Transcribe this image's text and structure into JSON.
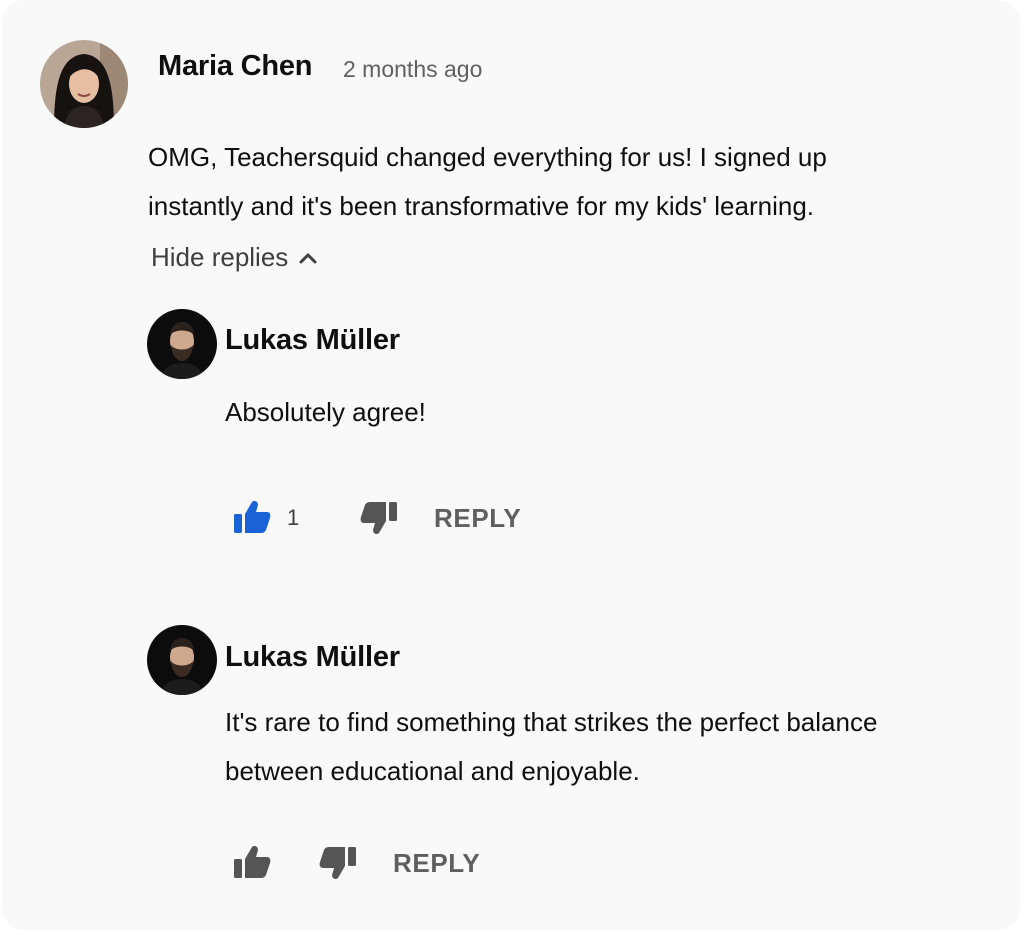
{
  "comment": {
    "author": "Maria Chen",
    "time": "2 months ago",
    "text_lines": [
      "OMG, Teachersquid changed everything for us! I signed up",
      "instantly and it's been transformative for my kids' learning."
    ],
    "toggle_label": "Hide replies"
  },
  "replies": [
    {
      "author": "Lukas Müller",
      "text_lines": [
        "Absolutely agree!"
      ],
      "like_count": "1",
      "liked": true,
      "reply_label": "REPLY"
    },
    {
      "author": "Lukas Müller",
      "text_lines": [
        "It's rare to find something that strikes the perfect balance",
        "between educational and enjoyable."
      ],
      "like_count": "",
      "liked": false,
      "reply_label": "REPLY"
    }
  ],
  "colors": {
    "liked": "#1a63d6",
    "icon": "#555555",
    "background": "#f9f9f9"
  },
  "icons": [
    "thumbs-up-icon",
    "thumbs-down-icon",
    "chevron-up-icon"
  ]
}
